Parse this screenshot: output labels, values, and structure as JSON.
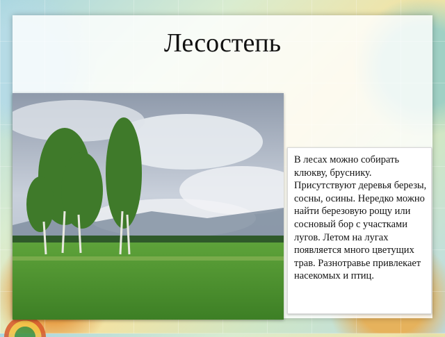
{
  "slide": {
    "title": "Лесостепь",
    "body_text": "В лесах можно собирать клюкву, бруснику. Присутствуют деревья березы, сосны, осины. Нередко можно найти березовую рощу или сосновый бор с участками лугов. Летом на лугах появляется много цветущих трав. Разнотравье привлекает насекомых и птиц."
  },
  "colors": {
    "sky": "#aab3c2",
    "grass": "#4f9a34",
    "tree": "#3f7a2a"
  }
}
